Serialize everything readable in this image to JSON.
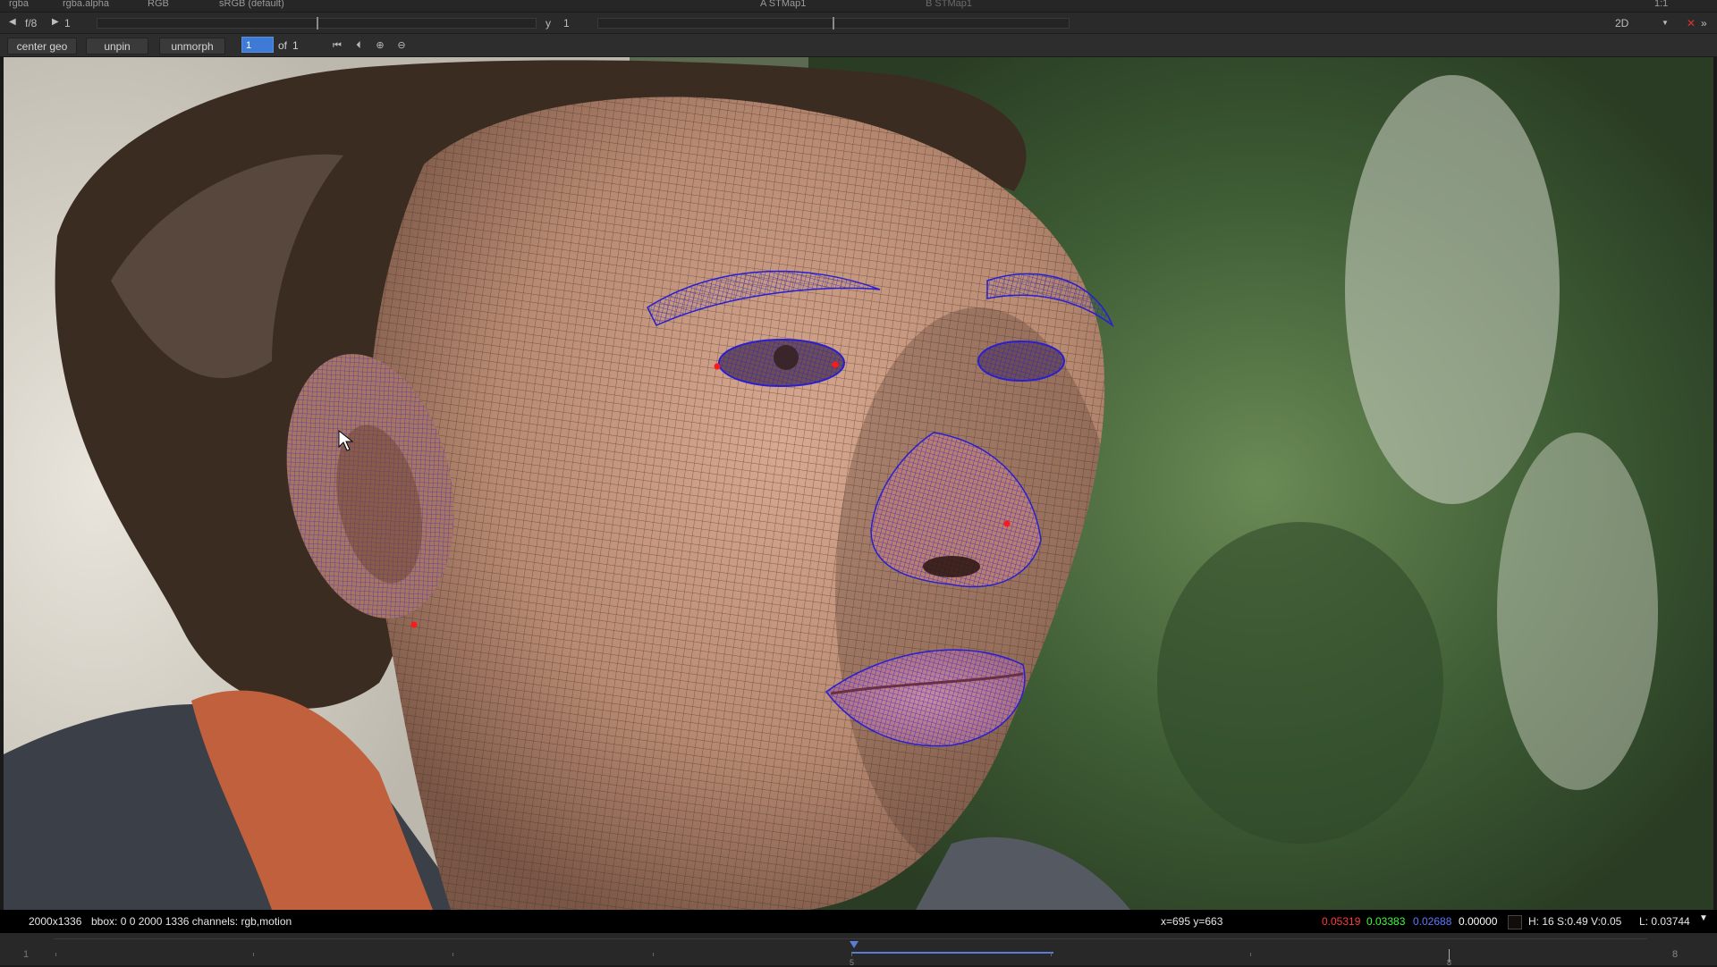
{
  "topbar1": {
    "channels": "rgba",
    "alpha": "rgba.alpha",
    "display": "RGB",
    "colorspace": "sRGB (default)",
    "input_a": "A  STMap1",
    "input_b": "B  STMap1",
    "zoom": "1:1"
  },
  "topbar2": {
    "fstop": "f/8",
    "frame_value": "1",
    "y_label": "y",
    "y_value": "1",
    "view_mode": "2D"
  },
  "toolbar": {
    "center_geo": "center geo",
    "unpin": "unpin",
    "unmorph": "unmorph",
    "frame_field": "1",
    "of_label": "of",
    "total_frames": "1"
  },
  "infobar": {
    "format": "2000x1336",
    "bbox": "bbox: 0 0 2000 1336 channels: rgb,motion",
    "coords": "x=695 y=663",
    "r": "0.05319",
    "g": "0.03383",
    "b": "0.02688",
    "a": "0.00000",
    "hsv": "H: 16 S:0.49 V:0.05",
    "luma": "L: 0.03744"
  },
  "timeline": {
    "start": "1",
    "mid": "5",
    "end": "8",
    "end_box": "8"
  },
  "colors": {
    "mesh": "#3a2f22",
    "feature_mesh": "#2a1fd0",
    "pin": "#ff1a1a",
    "rgb_r": "#ff3b3b",
    "rgb_g": "#3bff3b",
    "rgb_b": "#5a7bff",
    "accent": "#3d7bd6"
  }
}
